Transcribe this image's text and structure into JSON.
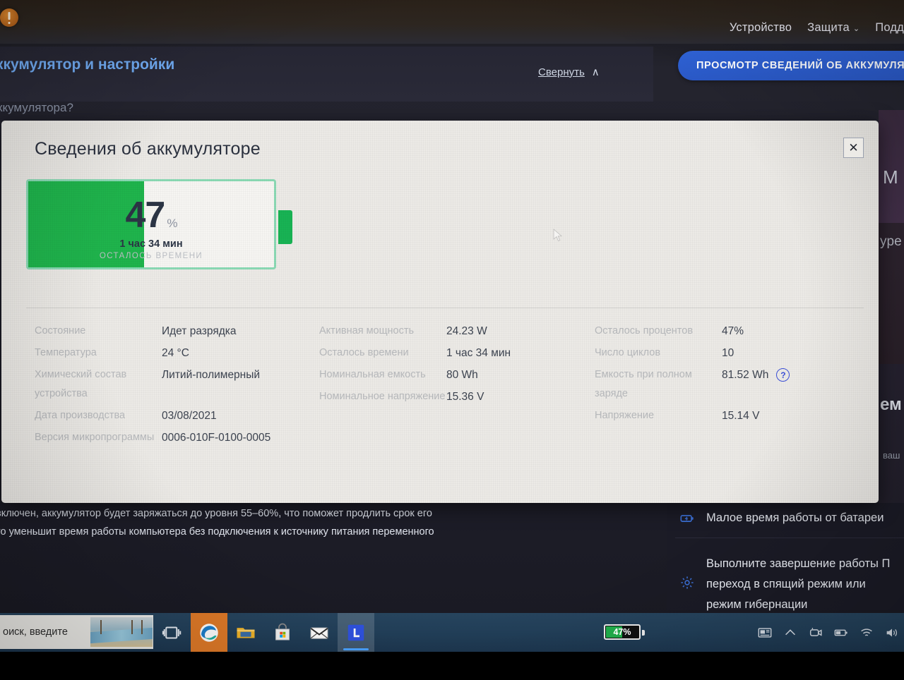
{
  "app": {
    "topnav": [
      {
        "label": "Устройство",
        "caret": ""
      },
      {
        "label": "Защита",
        "caret": "⌄"
      },
      {
        "label": "Подд",
        "caret": ""
      }
    ],
    "primary_button": "ПРОСМОТР СВЕДЕНИЙ ОБ АККУМУЛЯТ",
    "section_title": "ккумулятор и настройки",
    "collapse_label": "Свернуть",
    "collapse_caret": "∧",
    "subtitle_fragment": "ккумулятора?",
    "body_text_line1": "включен, аккумулятор будет заряжаться до уровня 55–60%, что поможет продлить срок его",
    "body_text_line2": "то уменьшит время работы компьютера без подключения к источнику питания переменного",
    "right_panel": {
      "items": [
        {
          "label": "Малое время работы от батареи",
          "icon": "battery-alert-icon"
        },
        {
          "label": "Выполните завершение работы П\nпереход в спящий режим или\nрежим гибернации",
          "icon": "gear-icon"
        }
      ]
    },
    "edge_fragments": [
      "M",
      "ype",
      "ем",
      "ваш"
    ]
  },
  "modal": {
    "title": "Сведения об аккумуляторе",
    "close_label": "✕",
    "gauge": {
      "percent_value": "47",
      "percent_unit": "%",
      "fill_percent": 47,
      "time_remaining": "1 час 34 мин",
      "caption": "ОСТАЛОСЬ ВРЕМЕНИ",
      "fill_color": "#1fb44c",
      "border_color": "#8ad9b4"
    },
    "columns": [
      {
        "rows": [
          {
            "key": "Состояние",
            "value": "Идет разрядка"
          },
          {
            "key": "Температура",
            "value": "24 °C"
          },
          {
            "key": "Химический состав устройства",
            "value": "Литий-полимерный"
          },
          {
            "key": "Дата производства",
            "value": "03/08/2021"
          },
          {
            "key": "Версия микропрограммы",
            "value": "0006-010F-0100-0005"
          }
        ]
      },
      {
        "rows": [
          {
            "key": "Активная мощность",
            "value": "24.23 W"
          },
          {
            "key": "Осталось времени",
            "value": "1 час 34 мин"
          },
          {
            "key": "Номинальная емкость",
            "value": "80 Wh"
          },
          {
            "key": "Номинальное напряжение",
            "value": "15.36 V"
          }
        ]
      },
      {
        "rows": [
          {
            "key": "Осталось процентов",
            "value": "47%"
          },
          {
            "key": "Число циклов",
            "value": "10"
          },
          {
            "key": "Емкость при полном заряде",
            "value": "81.52 Wh",
            "help": "?"
          },
          {
            "key": "Напряжение",
            "value": "15.14 V"
          }
        ]
      }
    ]
  },
  "taskbar": {
    "search_placeholder": "оиск, введите",
    "apps": [
      {
        "name": "task-view-icon",
        "label": "Представление задач"
      },
      {
        "name": "edge-icon",
        "label": "Microsoft Edge"
      },
      {
        "name": "file-explorer-icon",
        "label": "Проводник"
      },
      {
        "name": "microsoft-store-icon",
        "label": "Microsoft Store"
      },
      {
        "name": "mail-icon",
        "label": "Почта"
      },
      {
        "name": "lenovo-vantage-icon",
        "label": "L"
      }
    ],
    "battery_chip": "47%",
    "battery_chip_percent": 47,
    "tray_icons": [
      "news-widget-icon",
      "chevron-up-icon",
      "webcam-icon",
      "battery-icon",
      "wifi-icon",
      "volume-icon"
    ]
  }
}
